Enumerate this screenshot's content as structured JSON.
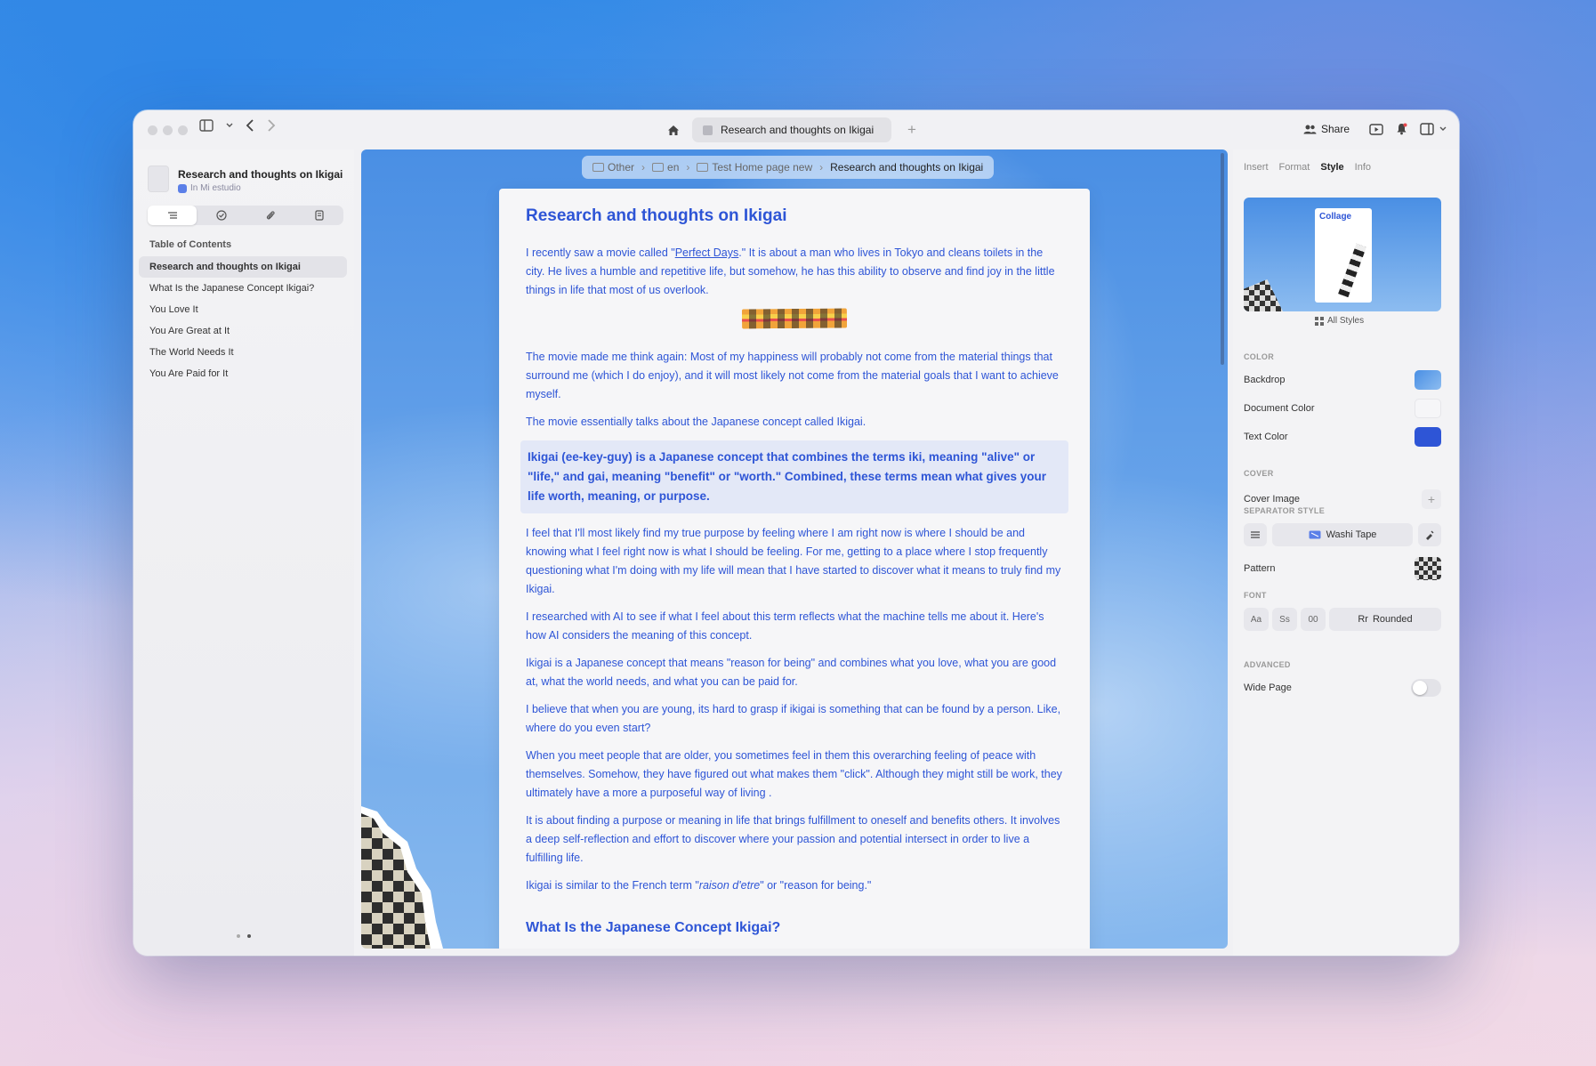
{
  "titlebar": {
    "tab_title": "Research and thoughts on Ikigai",
    "share_label": "Share"
  },
  "sidebar": {
    "doc_title": "Research and thoughts on Ikigai",
    "doc_location": "In Mi estudio",
    "toc_heading": "Table of Contents",
    "toc_items": [
      "Research and thoughts on Ikigai",
      "What Is the Japanese Concept Ikigai?",
      "You Love It",
      "You Are Great at It",
      "The World Needs It",
      "You Are Paid for It"
    ]
  },
  "breadcrumb": {
    "items": [
      "Other",
      "en",
      "Test Home page new"
    ],
    "current": "Research and thoughts on Ikigai"
  },
  "document": {
    "title": "Research and thoughts on Ikigai",
    "p1_before": "I recently saw a movie called \"",
    "p1_link": "Perfect Days",
    "p1_after": ".\" It is about a man who lives in Tokyo and cleans toilets in the city. He lives a humble and repetitive life, but somehow, he has this ability to observe and find joy in the little things in life that most of us overlook.",
    "p2": "The movie made me think again: Most of my happiness will probably not come from the material things that surround me (which I do enjoy), and it will most likely not come from the material goals that I want to achieve myself.",
    "p3": "The movie essentially talks about the Japanese concept called Ikigai.",
    "quote": "Ikigai (ee-key-guy) is a Japanese concept that combines the terms iki, meaning \"alive\" or \"life,\" and gai, meaning \"benefit\" or \"worth.\" Combined, these terms mean what gives your life worth, meaning, or purpose.",
    "p4": "I feel that I'll most likely find my true purpose by feeling where I am right now is where I should be and knowing what I feel right now is what I should be feeling. For me, getting to a place where I stop frequently questioning what I'm doing with my life will mean that I have started to discover what it means to truly find my Ikigai.",
    "p5": "I researched with AI to see if what I feel about this term reflects what the machine tells me about it. Here's how AI considers the meaning of this concept.",
    "p6": "Ikigai is a Japanese concept that means \"reason for being\" and combines what you love, what you are good at, what the world needs, and what you can be paid for.",
    "p7": "I believe that when you are young, its hard to grasp if ikigai is something that can be found by a person. Like, where do you even start?",
    "p8": "When you meet people that are older, you sometimes feel in them this overarching feeling of peace with themselves. Somehow, they have figured out what makes them \"click\". Although they might still be work, they ultimately have a more a purposeful way of living .",
    "p9": "It is about finding a purpose or meaning in life that brings fulfillment to oneself and benefits others. It involves a deep self-reflection and effort to discover where your passion and potential intersect in order to live a fulfilling life.",
    "p10_before": "Ikigai is similar to the French term \"",
    "p10_italic": "raison d'etre",
    "p10_after": "\" or \"reason for being.\"",
    "h2": "What Is the Japanese Concept Ikigai?"
  },
  "inspector": {
    "tabs": [
      "Insert",
      "Format",
      "Style",
      "Info"
    ],
    "active_tab": "Style",
    "collage_label": "Collage",
    "all_styles_label": "All Styles",
    "color_heading": "COLOR",
    "backdrop_label": "Backdrop",
    "document_color_label": "Document Color",
    "text_color_label": "Text Color",
    "cover_heading": "COVER",
    "cover_image_label": "Cover Image",
    "separator_heading": "SEPARATOR STYLE",
    "separator_value": "Washi Tape",
    "pattern_label": "Pattern",
    "font_heading": "FONT",
    "font_options": [
      "Aa",
      "Ss",
      "00"
    ],
    "font_selected_glyph": "Rr",
    "font_selected": "Rounded",
    "advanced_heading": "ADVANCED",
    "wide_page_label": "Wide Page",
    "wide_page_on": false
  },
  "colors": {
    "text_color": "#2e55d6",
    "backdrop": "#6aa5ea",
    "document_color": "#f6f6f8"
  }
}
